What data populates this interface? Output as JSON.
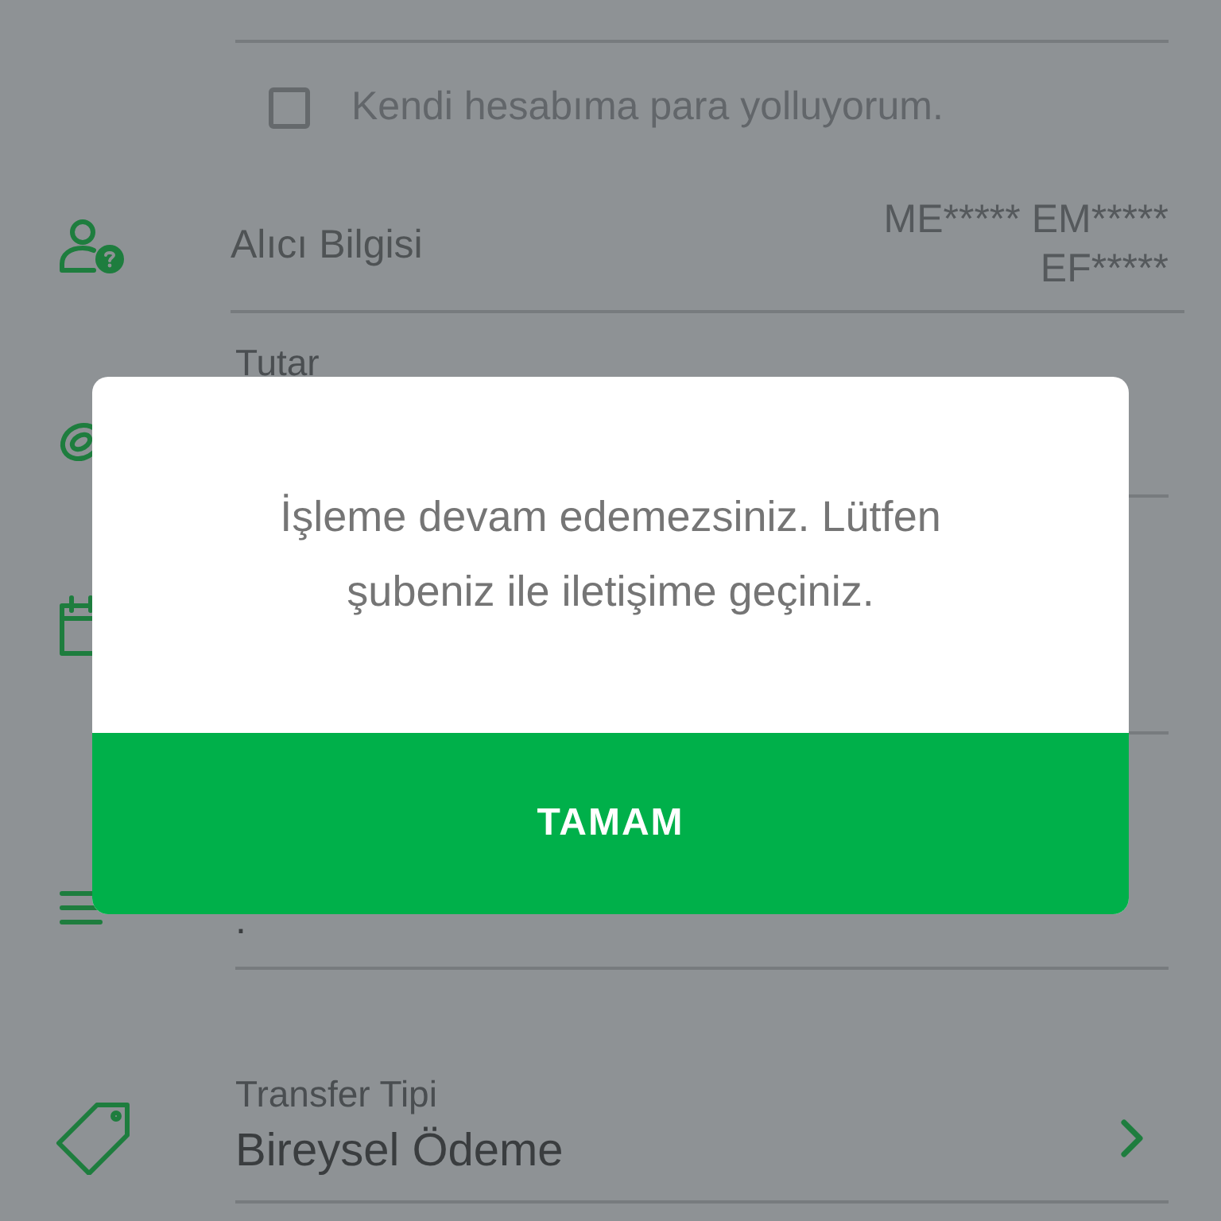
{
  "form": {
    "own_account": {
      "label": "Kendi hesabıma para yolluyorum.",
      "checked": false
    },
    "recipient_info": {
      "label": "Alıcı Bilgisi",
      "value_lines": [
        "ME***** EM*****",
        "EF*****"
      ]
    },
    "amount": {
      "label": "Tutar"
    },
    "field_4": {
      "value": "."
    },
    "transfer_type": {
      "label": "Transfer Tipi",
      "value": "Bireysel Ödeme"
    }
  },
  "dialog": {
    "message": "İşleme devam edemezsiniz. Lütfen şubeniz ile iletişime geçiniz.",
    "button": "TAMAM"
  }
}
